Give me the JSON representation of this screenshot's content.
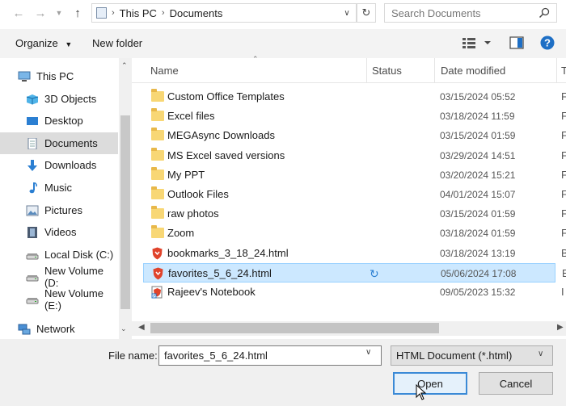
{
  "address": {
    "crumbs": [
      "This PC",
      "Documents"
    ]
  },
  "search": {
    "placeholder": "Search Documents"
  },
  "toolbar": {
    "organize_label": "Organize",
    "new_folder_label": "New folder"
  },
  "sidebar": {
    "items": [
      {
        "label": "This PC",
        "icon": "computer-icon"
      },
      {
        "label": "3D Objects",
        "icon": "cube-icon"
      },
      {
        "label": "Desktop",
        "icon": "desktop-icon"
      },
      {
        "label": "Documents",
        "icon": "document-icon",
        "selected": true
      },
      {
        "label": "Downloads",
        "icon": "download-arrow-icon"
      },
      {
        "label": "Music",
        "icon": "music-note-icon"
      },
      {
        "label": "Pictures",
        "icon": "pictures-icon"
      },
      {
        "label": "Videos",
        "icon": "film-icon"
      },
      {
        "label": "Local Disk (C:)",
        "icon": "drive-icon"
      },
      {
        "label": "New Volume (D:",
        "icon": "drive-icon"
      },
      {
        "label": "New Volume (E:)",
        "icon": "drive-icon"
      },
      {
        "label": "Network",
        "icon": "network-icon"
      }
    ]
  },
  "columns": {
    "name": "Name",
    "status": "Status",
    "date": "Date modified",
    "type": "T"
  },
  "files": [
    {
      "name": "Custom Office Templates",
      "date": "03/15/2024 05:52",
      "type": "F",
      "kind": "folder"
    },
    {
      "name": "Excel files",
      "date": "03/18/2024 11:59",
      "type": "F",
      "kind": "folder"
    },
    {
      "name": "MEGAsync Downloads",
      "date": "03/15/2024 01:59",
      "type": "F",
      "kind": "folder"
    },
    {
      "name": "MS Excel saved versions",
      "date": "03/29/2024 14:51",
      "type": "F",
      "kind": "folder"
    },
    {
      "name": "My PPT",
      "date": "03/20/2024 15:21",
      "type": "F",
      "kind": "folder"
    },
    {
      "name": "Outlook Files",
      "date": "04/01/2024 15:07",
      "type": "F",
      "kind": "folder"
    },
    {
      "name": "raw photos",
      "date": "03/15/2024 01:59",
      "type": "F",
      "kind": "folder"
    },
    {
      "name": "Zoom",
      "date": "03/18/2024 01:59",
      "type": "F",
      "kind": "folder"
    },
    {
      "name": "bookmarks_3_18_24.html",
      "date": "03/18/2024 13:19",
      "type": "B",
      "kind": "html"
    },
    {
      "name": "favorites_5_6_24.html",
      "date": "05/06/2024 17:08",
      "type": "B",
      "kind": "html",
      "selected": true,
      "status": "sync-icon"
    },
    {
      "name": "Rajeev's Notebook",
      "date": "09/05/2023 15:32",
      "type": "I",
      "kind": "shortcut"
    }
  ],
  "footer": {
    "file_name_label": "File name:",
    "file_name_value": "favorites_5_6_24.html",
    "file_type_value": "HTML Document (*.html)",
    "open_label": "Open",
    "cancel_label": "Cancel"
  },
  "colors": {
    "selection_bg": "#cce8ff",
    "selection_border": "#99d1ff",
    "folder": "#f8d775",
    "html_icon": "#e0442c",
    "accent": "#3b8ad6"
  }
}
